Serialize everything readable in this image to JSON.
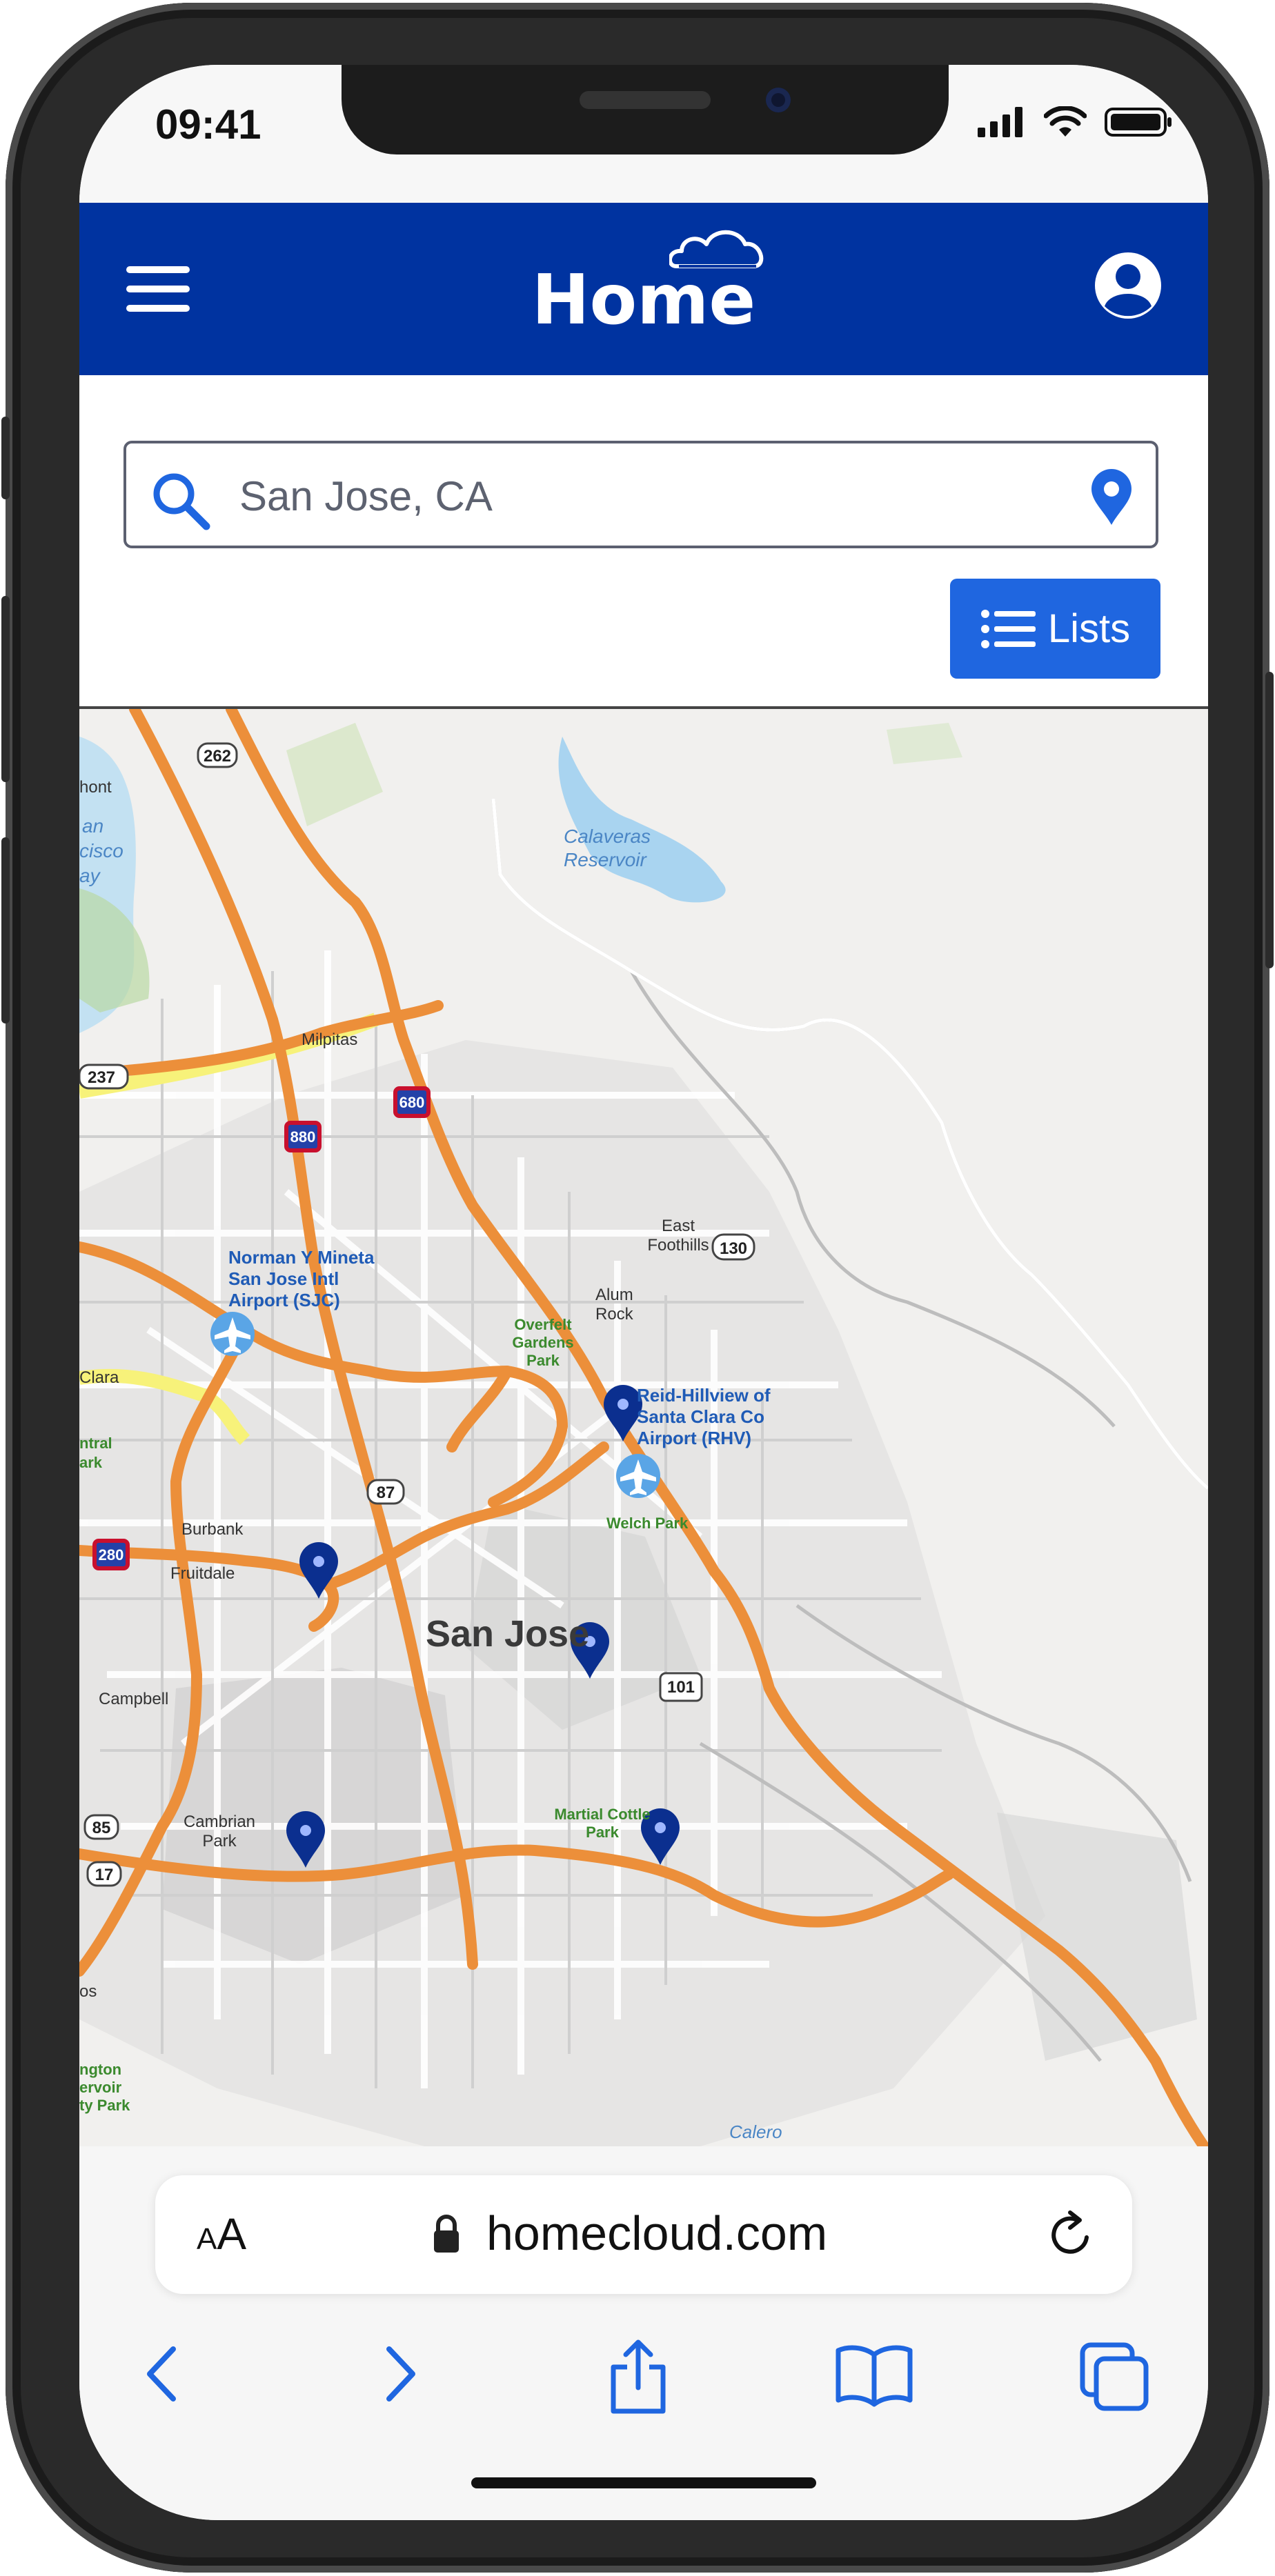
{
  "status_bar": {
    "time": "09:41"
  },
  "header": {
    "title": "Home",
    "menu_icon": "hamburger-menu-icon",
    "account_icon": "user-account-icon",
    "brand_color": "#0033a0"
  },
  "search": {
    "value": "San Jose, CA",
    "search_icon": "search-icon",
    "location_icon": "location-pin-icon"
  },
  "lists_button": {
    "label": "Lists",
    "icon": "list-icon",
    "color": "#1f66e0"
  },
  "map": {
    "city_label": "San Jose",
    "places": [
      {
        "name": "Norman Y Mineta San Jose Intl Airport (SJC)",
        "lines": [
          "Norman Y Mineta",
          "San Jose Intl",
          "Airport (SJC)"
        ]
      },
      {
        "name": "Reid-Hillview of Santa Clara Co Airport (RHV)",
        "lines": [
          "Reid-Hillview of",
          "Santa Clara Co",
          "Airport (RHV)"
        ]
      },
      {
        "name": "Calaveras Reservoir",
        "lines": [
          "Calaveras",
          "Reservoir"
        ]
      },
      {
        "name": "Milpitas"
      },
      {
        "name": "East Foothills"
      },
      {
        "name": "Alum Rock"
      },
      {
        "name": "Overfelt Gardens Park"
      },
      {
        "name": "Welch Park"
      },
      {
        "name": "Burbank"
      },
      {
        "name": "Fruitdale"
      },
      {
        "name": "Campbell"
      },
      {
        "name": "Cambrian Park"
      },
      {
        "name": "Martial Cottle Park"
      },
      {
        "name": "Calero"
      }
    ],
    "highway_shields": [
      "262",
      "237",
      "880",
      "680",
      "130",
      "87",
      "280",
      "101",
      "85",
      "17"
    ],
    "edge_fragments": [
      "hont",
      "an",
      "cisco",
      "ay",
      "Clara",
      "ntral",
      "ark",
      "os",
      "ngton",
      "ervoir",
      "ty Park"
    ],
    "markers_count": 5
  },
  "browser": {
    "aa_small": "A",
    "aa_big": "A",
    "url": "homecloud.com"
  },
  "toolbar_icons": [
    "back-icon",
    "forward-icon",
    "share-icon",
    "bookmarks-icon",
    "tabs-icon"
  ]
}
